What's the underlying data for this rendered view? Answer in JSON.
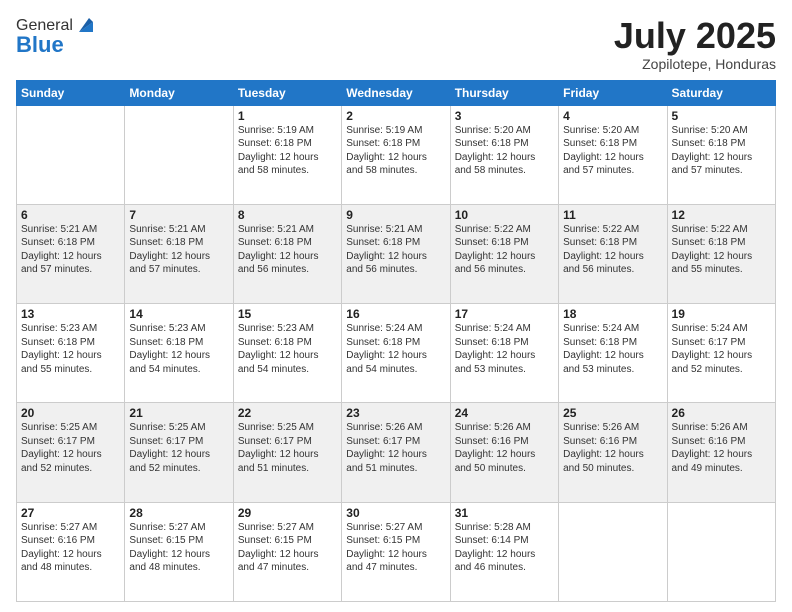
{
  "logo": {
    "general": "General",
    "blue": "Blue"
  },
  "header": {
    "month_year": "July 2025",
    "location": "Zopilotepe, Honduras"
  },
  "weekdays": [
    "Sunday",
    "Monday",
    "Tuesday",
    "Wednesday",
    "Thursday",
    "Friday",
    "Saturday"
  ],
  "weeks": [
    [
      {
        "day": "",
        "info": ""
      },
      {
        "day": "",
        "info": ""
      },
      {
        "day": "1",
        "info": "Sunrise: 5:19 AM\nSunset: 6:18 PM\nDaylight: 12 hours and 58 minutes."
      },
      {
        "day": "2",
        "info": "Sunrise: 5:19 AM\nSunset: 6:18 PM\nDaylight: 12 hours and 58 minutes."
      },
      {
        "day": "3",
        "info": "Sunrise: 5:20 AM\nSunset: 6:18 PM\nDaylight: 12 hours and 58 minutes."
      },
      {
        "day": "4",
        "info": "Sunrise: 5:20 AM\nSunset: 6:18 PM\nDaylight: 12 hours and 57 minutes."
      },
      {
        "day": "5",
        "info": "Sunrise: 5:20 AM\nSunset: 6:18 PM\nDaylight: 12 hours and 57 minutes."
      }
    ],
    [
      {
        "day": "6",
        "info": "Sunrise: 5:21 AM\nSunset: 6:18 PM\nDaylight: 12 hours and 57 minutes."
      },
      {
        "day": "7",
        "info": "Sunrise: 5:21 AM\nSunset: 6:18 PM\nDaylight: 12 hours and 57 minutes."
      },
      {
        "day": "8",
        "info": "Sunrise: 5:21 AM\nSunset: 6:18 PM\nDaylight: 12 hours and 56 minutes."
      },
      {
        "day": "9",
        "info": "Sunrise: 5:21 AM\nSunset: 6:18 PM\nDaylight: 12 hours and 56 minutes."
      },
      {
        "day": "10",
        "info": "Sunrise: 5:22 AM\nSunset: 6:18 PM\nDaylight: 12 hours and 56 minutes."
      },
      {
        "day": "11",
        "info": "Sunrise: 5:22 AM\nSunset: 6:18 PM\nDaylight: 12 hours and 56 minutes."
      },
      {
        "day": "12",
        "info": "Sunrise: 5:22 AM\nSunset: 6:18 PM\nDaylight: 12 hours and 55 minutes."
      }
    ],
    [
      {
        "day": "13",
        "info": "Sunrise: 5:23 AM\nSunset: 6:18 PM\nDaylight: 12 hours and 55 minutes."
      },
      {
        "day": "14",
        "info": "Sunrise: 5:23 AM\nSunset: 6:18 PM\nDaylight: 12 hours and 54 minutes."
      },
      {
        "day": "15",
        "info": "Sunrise: 5:23 AM\nSunset: 6:18 PM\nDaylight: 12 hours and 54 minutes."
      },
      {
        "day": "16",
        "info": "Sunrise: 5:24 AM\nSunset: 6:18 PM\nDaylight: 12 hours and 54 minutes."
      },
      {
        "day": "17",
        "info": "Sunrise: 5:24 AM\nSunset: 6:18 PM\nDaylight: 12 hours and 53 minutes."
      },
      {
        "day": "18",
        "info": "Sunrise: 5:24 AM\nSunset: 6:18 PM\nDaylight: 12 hours and 53 minutes."
      },
      {
        "day": "19",
        "info": "Sunrise: 5:24 AM\nSunset: 6:17 PM\nDaylight: 12 hours and 52 minutes."
      }
    ],
    [
      {
        "day": "20",
        "info": "Sunrise: 5:25 AM\nSunset: 6:17 PM\nDaylight: 12 hours and 52 minutes."
      },
      {
        "day": "21",
        "info": "Sunrise: 5:25 AM\nSunset: 6:17 PM\nDaylight: 12 hours and 52 minutes."
      },
      {
        "day": "22",
        "info": "Sunrise: 5:25 AM\nSunset: 6:17 PM\nDaylight: 12 hours and 51 minutes."
      },
      {
        "day": "23",
        "info": "Sunrise: 5:26 AM\nSunset: 6:17 PM\nDaylight: 12 hours and 51 minutes."
      },
      {
        "day": "24",
        "info": "Sunrise: 5:26 AM\nSunset: 6:16 PM\nDaylight: 12 hours and 50 minutes."
      },
      {
        "day": "25",
        "info": "Sunrise: 5:26 AM\nSunset: 6:16 PM\nDaylight: 12 hours and 50 minutes."
      },
      {
        "day": "26",
        "info": "Sunrise: 5:26 AM\nSunset: 6:16 PM\nDaylight: 12 hours and 49 minutes."
      }
    ],
    [
      {
        "day": "27",
        "info": "Sunrise: 5:27 AM\nSunset: 6:16 PM\nDaylight: 12 hours and 48 minutes."
      },
      {
        "day": "28",
        "info": "Sunrise: 5:27 AM\nSunset: 6:15 PM\nDaylight: 12 hours and 48 minutes."
      },
      {
        "day": "29",
        "info": "Sunrise: 5:27 AM\nSunset: 6:15 PM\nDaylight: 12 hours and 47 minutes."
      },
      {
        "day": "30",
        "info": "Sunrise: 5:27 AM\nSunset: 6:15 PM\nDaylight: 12 hours and 47 minutes."
      },
      {
        "day": "31",
        "info": "Sunrise: 5:28 AM\nSunset: 6:14 PM\nDaylight: 12 hours and 46 minutes."
      },
      {
        "day": "",
        "info": ""
      },
      {
        "day": "",
        "info": ""
      }
    ]
  ]
}
